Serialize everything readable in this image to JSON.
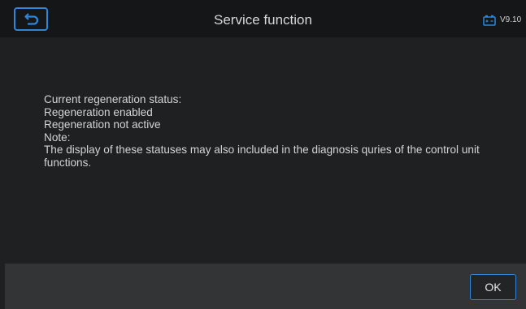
{
  "header": {
    "title": "Service function",
    "back_icon": "back-arrow-icon",
    "version_icon": "battery-icon",
    "version": "V9.10"
  },
  "content": {
    "lines": [
      "Current regeneration status:",
      "Regeneration enabled",
      "Regeneration not active",
      "Note:",
      "The display of these statuses may also included in the diagnosis quries of the control unit functions."
    ]
  },
  "footer": {
    "ok_label": "OK"
  },
  "colors": {
    "accent": "#2f86d9",
    "background": "#1f2022",
    "header_background": "#151617",
    "footer_background": "#333436"
  }
}
